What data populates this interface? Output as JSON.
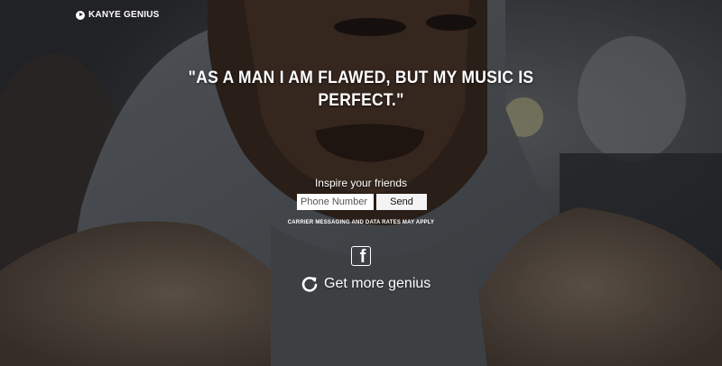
{
  "brand": {
    "label": "KANYE GENIUS",
    "icon": "play-circle-icon"
  },
  "quote": {
    "line1": "\"AS A MAN I AM FLAWED, BUT MY MUSIC IS",
    "line2": "PERFECT.\""
  },
  "inspire": {
    "heading": "Inspire your friends"
  },
  "phone": {
    "placeholder": "Phone Number",
    "value": ""
  },
  "send": {
    "label": "Send"
  },
  "disclaimer": "CARRIER MESSAGING AND DATA RATES MAY APPLY",
  "facebook": {
    "icon": "facebook-icon",
    "glyph": "f"
  },
  "more": {
    "label": "Get more genius",
    "icon": "refresh-icon"
  },
  "colors": {
    "text": "#ffffff",
    "button_bg": "#f4f4f4",
    "overlay": "#000000"
  }
}
